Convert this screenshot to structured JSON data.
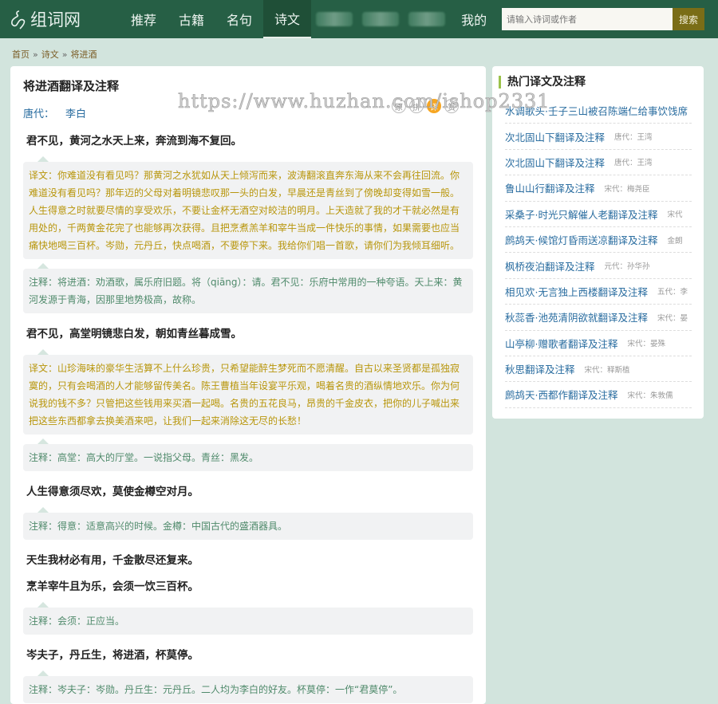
{
  "header": {
    "logo": "组词网",
    "nav": [
      {
        "label": "推荐"
      },
      {
        "label": "古籍"
      },
      {
        "label": "名句"
      },
      {
        "label": "诗文",
        "active": true
      }
    ],
    "nav_last": "我的",
    "search_placeholder": "请输入诗词或作者",
    "search_button": "搜索"
  },
  "breadcrumb": [
    "首页",
    "诗文",
    "将进酒"
  ],
  "watermark": "https://www.huzhan.com/ishop2331",
  "article": {
    "title": "将进酒翻译及注释",
    "dynasty": "唐代：",
    "author": "李白",
    "tools": [
      "原",
      "拼",
      "译",
      "赏"
    ],
    "sections": [
      {
        "verse": "君不见，黄河之水天上来，奔流到海不复回。",
        "translation": "译文：你难道没有看见吗？那黄河之水犹如从天上倾泻而来，波涛翻滚直奔东海从来不会再往回流。你难道没有看见吗？那年迈的父母对着明镜悲叹那一头的白发，早晨还是青丝到了傍晚却变得如雪一般。人生得意之时就要尽情的享受欢乐，不要让金杯无酒空对皎洁的明月。上天造就了我的才干就必然是有用处的，千两黄金花完了也能够再次获得。且把烹煮羔羊和宰牛当成一件快乐的事情，如果需要也应当痛快地喝三百杯。岑勋，元丹丘，快点喝酒，不要停下来。我给你们唱一首歌，请你们为我倾耳细听。",
        "note": "注释：将进酒：劝酒歌，属乐府旧题。将（qiāng）：请。君不见：乐府中常用的一种夸语。天上来：黄河发源于青海，因那里地势极高，故称。"
      },
      {
        "verse": "君不见，高堂明镜悲白发，朝如青丝暮成雪。",
        "translation": "译文：山珍海味的豪华生活算不上什么珍贵，只希望能醉生梦死而不愿清醒。自古以来圣贤都是孤独寂寞的，只有会喝酒的人才能够留传美名。陈王曹植当年设宴平乐观，喝着名贵的酒纵情地欢乐。你为何说我的钱不多？只管把这些钱用来买酒一起喝。名贵的五花良马，昂贵的千金皮衣，把你的儿子喊出来把这些东西都拿去换美酒来吧，让我们一起来消除这无尽的长愁！",
        "note": "注释：高堂：高大的厅堂。一说指父母。青丝：黑发。"
      },
      {
        "verse": "人生得意须尽欢，莫使金樽空对月。",
        "note": "注释：得意：适意高兴的时候。金樽：中国古代的盛酒器具。"
      },
      {
        "verse": "天生我材必有用，千金散尽还复来。"
      },
      {
        "verse": "烹羊宰牛且为乐，会须一饮三百杯。",
        "note": "注释：会须：正应当。"
      },
      {
        "verse": "岑夫子，丹丘生，将进酒，杯莫停。",
        "note": "注释：岑夫子：岑勋。丹丘生：元丹丘。二人均为李白的好友。杯莫停：一作“君莫停”。"
      }
    ]
  },
  "sidebar": {
    "title": "热门译文及注释",
    "items": [
      {
        "title": "水调歌头·壬子三山被召陈端仁给事饮饯席",
        "author": ""
      },
      {
        "title": "次北固山下翻译及注释",
        "author": "唐代：王湾"
      },
      {
        "title": "次北固山下翻译及注释",
        "author": "唐代：王湾"
      },
      {
        "title": "鲁山山行翻译及注释",
        "author": "宋代：梅尧臣"
      },
      {
        "title": "采桑子·时光只解催人老翻译及注释",
        "author": "宋代"
      },
      {
        "title": "鹧鸪天·候馆灯昏雨送凉翻译及注释",
        "author": "金朗"
      },
      {
        "title": "枫桥夜泊翻译及注释",
        "author": "元代：孙华孙"
      },
      {
        "title": "相见欢·无言独上西楼翻译及注释",
        "author": "五代：李"
      },
      {
        "title": "秋蕊香·池苑清阴欲就翻译及注释",
        "author": "宋代：晏"
      },
      {
        "title": "山亭柳·赠歌者翻译及注释",
        "author": "宋代：晏殊"
      },
      {
        "title": "秋思翻译及注释",
        "author": "宋代：释斯植"
      },
      {
        "title": "鹧鸪天·西都作翻译及注释",
        "author": "宋代：朱敦儒"
      }
    ]
  }
}
